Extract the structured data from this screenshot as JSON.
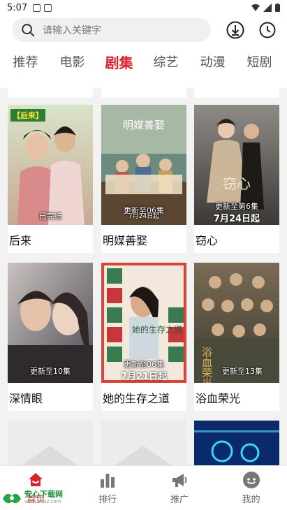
{
  "status_bar": {
    "time": "5:07"
  },
  "search": {
    "placeholder": "请输入关键字"
  },
  "tabs": [
    {
      "label": "推荐"
    },
    {
      "label": "电影"
    },
    {
      "label": "剧集"
    },
    {
      "label": "综艺"
    },
    {
      "label": "动漫"
    },
    {
      "label": "短剧"
    }
  ],
  "active_tab": "剧集",
  "cards": [
    {
      "title": "后来",
      "overlay": "已完结",
      "tag": "【后来】"
    },
    {
      "title": "明媒善娶",
      "overlay": "更新至06集",
      "overlay2": "7月24日起",
      "poster_text": "明媒善娶"
    },
    {
      "title": "窃心",
      "overlay": "更新至第6集",
      "big_date": "7月24日起",
      "poster_text": "窃心"
    },
    {
      "title": "深情眼",
      "overlay": "更新至10集"
    },
    {
      "title": "她的生存之道",
      "overlay": "更新至06集",
      "big_date": "7月21日起",
      "poster_text": "她的生存之道"
    },
    {
      "title": "浴血荣光",
      "overlay": "更新至13集",
      "poster_text": "浴血荣光"
    }
  ],
  "bottom_nav": [
    {
      "label": "首页",
      "icon": "home-icon"
    },
    {
      "label": "排行",
      "icon": "bar-chart-icon"
    },
    {
      "label": "推广",
      "icon": "megaphone-icon"
    },
    {
      "label": "我的",
      "icon": "profile-icon"
    }
  ],
  "watermark": {
    "name": "安心下载网",
    "url": "www.anxz.com"
  },
  "colors": {
    "accent": "#d9232d",
    "background": "#f2f2f2"
  }
}
